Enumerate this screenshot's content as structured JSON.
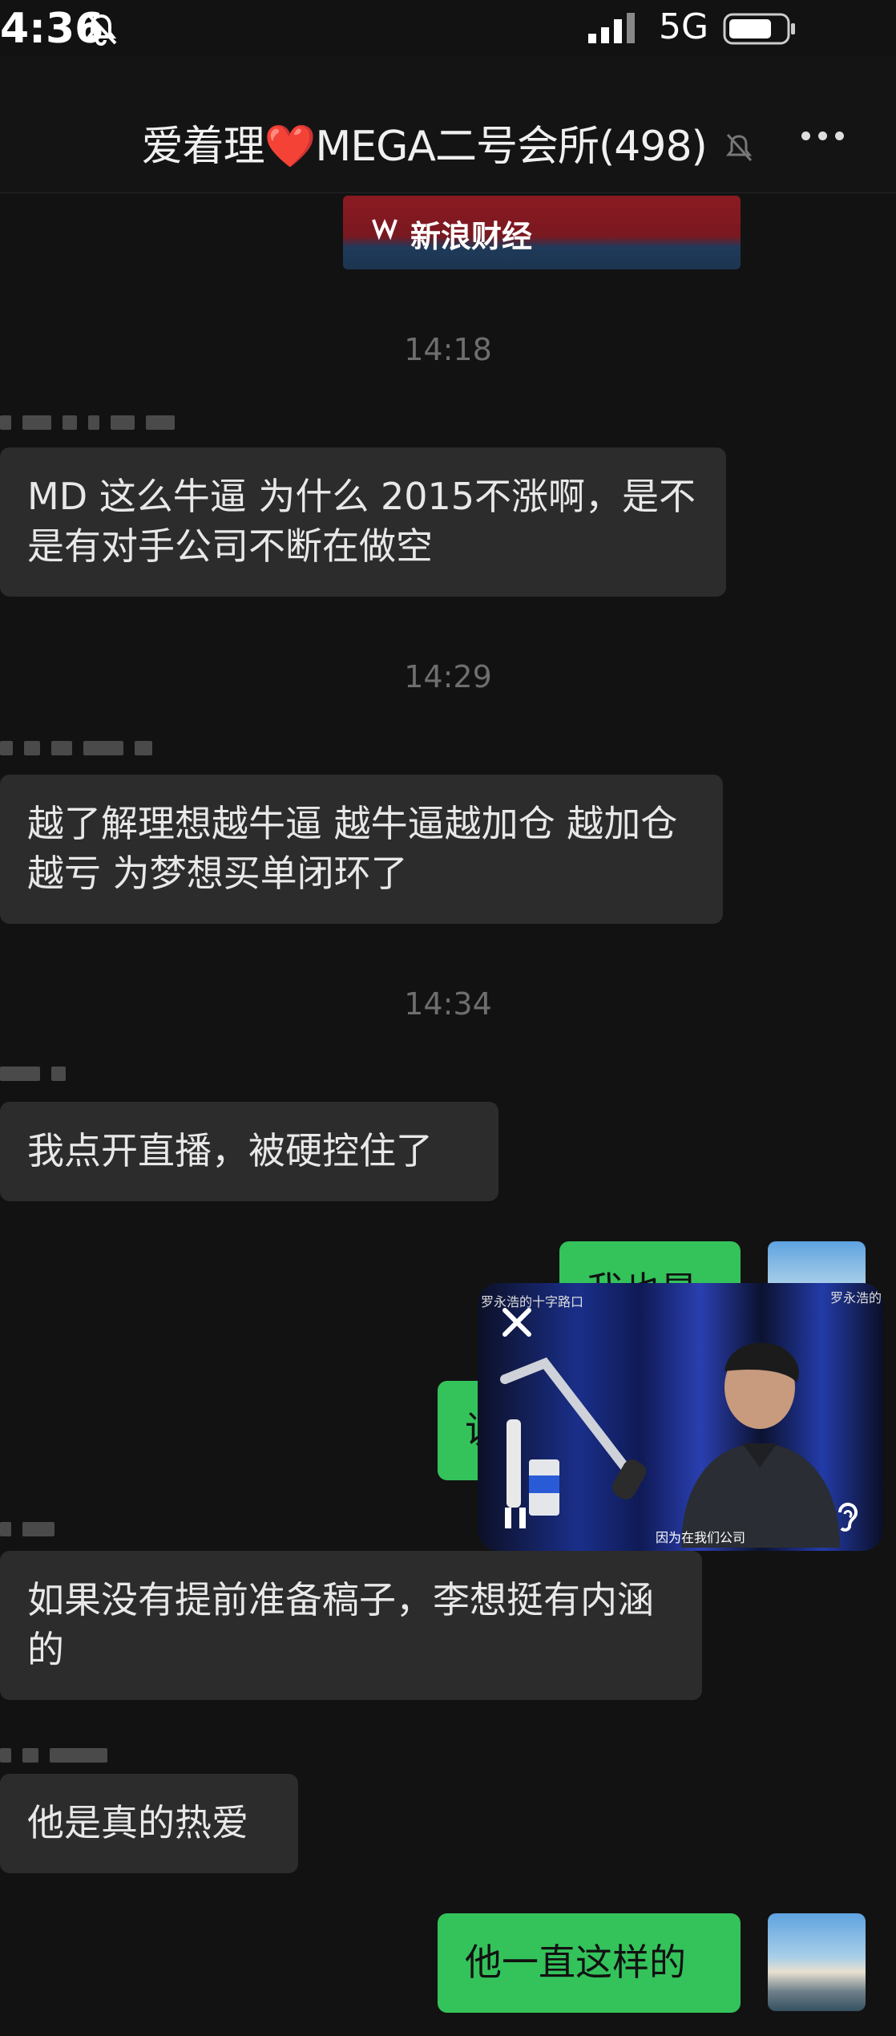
{
  "status_bar": {
    "time": "4:36",
    "network": "5G"
  },
  "header": {
    "title_prefix": "爱着理",
    "heart": "❤️",
    "title_suffix": "MEGA二号会所",
    "member_count": "(498)"
  },
  "shared_card": {
    "source": "新浪财经"
  },
  "messages": [
    {
      "type": "time",
      "text": "14:18"
    },
    {
      "type": "bubble",
      "side": "left",
      "text": "MD 这么牛逼 为什么 2015不涨啊，是不是有对手公司不断在做空"
    },
    {
      "type": "time",
      "text": "14:29"
    },
    {
      "type": "bubble",
      "side": "left",
      "text": "越了解理想越牛逼 越牛逼越加仓 越加仓越亏 为梦想买单闭环了"
    },
    {
      "type": "time",
      "text": "14:34"
    },
    {
      "type": "bubble",
      "side": "left",
      "text": "我点开直播，被硬控住了"
    },
    {
      "type": "bubble",
      "side": "right",
      "text": "我也是"
    },
    {
      "type": "bubble",
      "side": "right",
      "text": "说"
    },
    {
      "type": "bubble",
      "side": "left",
      "text": "如果没有提前准备稿子，李想挺有内涵的"
    },
    {
      "type": "bubble",
      "side": "left",
      "text": "他是真的热爱"
    },
    {
      "type": "bubble",
      "side": "right",
      "text": "他一直这样的"
    }
  ],
  "video_pip": {
    "top_label": "罗永浩的十字路口",
    "right_label": "罗永浩的",
    "subtitle": "因为在我们公司"
  },
  "colors": {
    "background": "#121212",
    "bubble_in": "#2c2c2c",
    "bubble_out": "#34c25b"
  }
}
